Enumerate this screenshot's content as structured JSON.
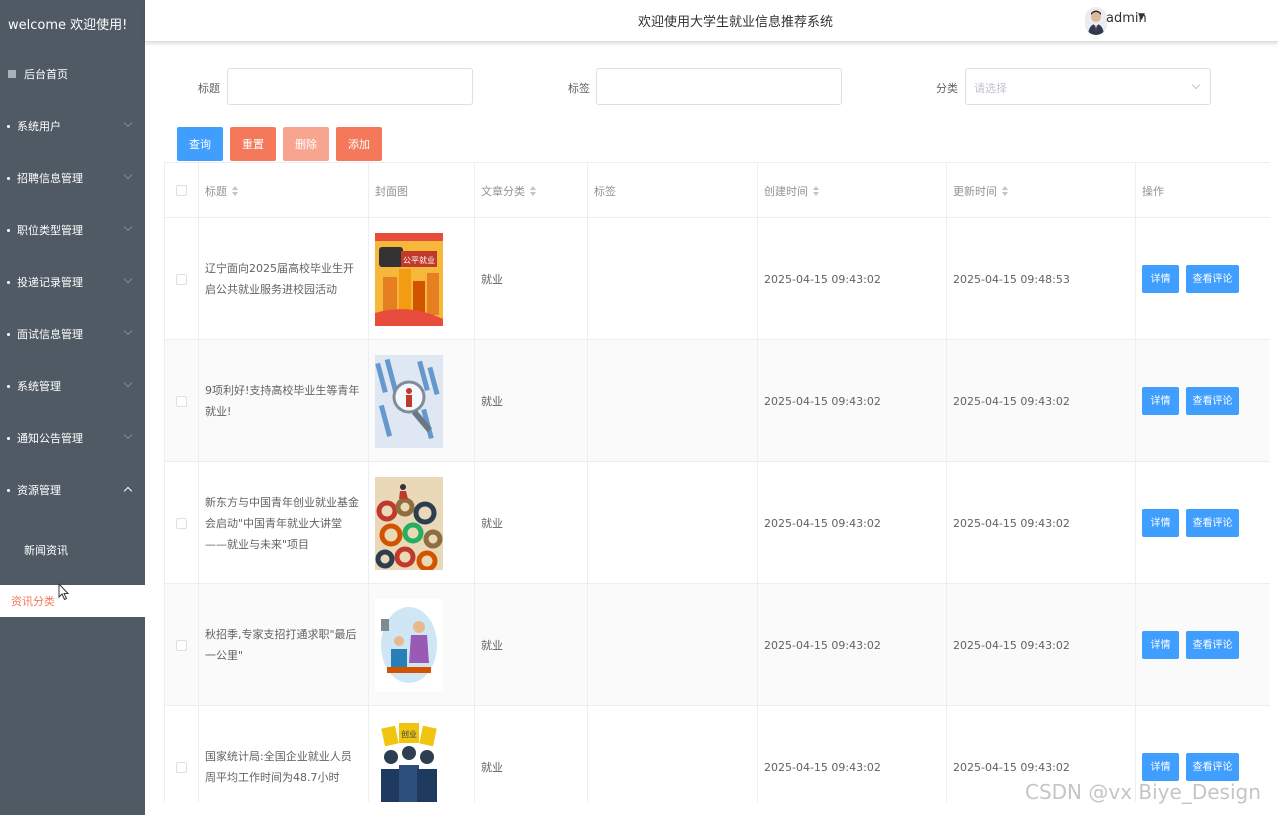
{
  "sidebar": {
    "brand": "welcome 欢迎使用!",
    "home": "后台首页",
    "menu": [
      {
        "label": "系统用户",
        "expanded": false
      },
      {
        "label": "招聘信息管理",
        "expanded": false
      },
      {
        "label": "职位类型管理",
        "expanded": false
      },
      {
        "label": "投递记录管理",
        "expanded": false
      },
      {
        "label": "面试信息管理",
        "expanded": false
      },
      {
        "label": "系统管理",
        "expanded": false
      },
      {
        "label": "通知公告管理",
        "expanded": false
      },
      {
        "label": "资源管理",
        "expanded": true
      }
    ],
    "submenu": [
      {
        "label": "新闻资讯",
        "active": false
      },
      {
        "label": "资讯分类",
        "active": true
      }
    ]
  },
  "header": {
    "title": "欢迎使用大学生就业信息推荐系统",
    "user": "admin",
    "avatar_icon": "user-avatar-icon"
  },
  "search": {
    "title_label": "标题",
    "title_value": "",
    "tag_label": "标签",
    "tag_value": "",
    "category_label": "分类",
    "category_placeholder": "请选择"
  },
  "actions": {
    "query": "查询",
    "reset": "重置",
    "delete": "删除",
    "add": "添加"
  },
  "colors": {
    "sidebar_bg": "#4f5a64",
    "primary": "#409eff",
    "danger": "#f4795b",
    "danger_light": "#f8a58f",
    "active_text": "#f4795b"
  },
  "table": {
    "columns": [
      "标题",
      "封面图",
      "文章分类",
      "标签",
      "创建时间",
      "更新时间",
      "操作"
    ],
    "rows": [
      {
        "title": "辽宁面向2025届高校毕业生开启公共就业服务进校园活动",
        "category": "就业",
        "tag": "",
        "created": "2025-04-15 09:43:02",
        "updated": "2025-04-15 09:48:53",
        "cover_text": "公平就业"
      },
      {
        "title": "9项利好!支持高校毕业生等青年就业!",
        "category": "就业",
        "tag": "",
        "created": "2025-04-15 09:43:02",
        "updated": "2025-04-15 09:43:02",
        "cover_text": ""
      },
      {
        "title": "新东方与中国青年创业就业基金会启动\"中国青年就业大讲堂——就业与未来\"项目",
        "category": "就业",
        "tag": "",
        "created": "2025-04-15 09:43:02",
        "updated": "2025-04-15 09:43:02",
        "cover_text": ""
      },
      {
        "title": "秋招季,专家支招打通求职\"最后一公里\"",
        "category": "就业",
        "tag": "",
        "created": "2025-04-15 09:43:02",
        "updated": "2025-04-15 09:43:02",
        "cover_text": ""
      },
      {
        "title": "国家统计局:全国企业就业人员周平均工作时间为48.7小时",
        "category": "就业",
        "tag": "",
        "created": "2025-04-15 09:43:02",
        "updated": "2025-04-15 09:43:02",
        "cover_text": "创业"
      }
    ],
    "row_actions": {
      "detail": "详情",
      "comments": "查看评论"
    }
  },
  "watermark": "CSDN @vx Biye_Design"
}
